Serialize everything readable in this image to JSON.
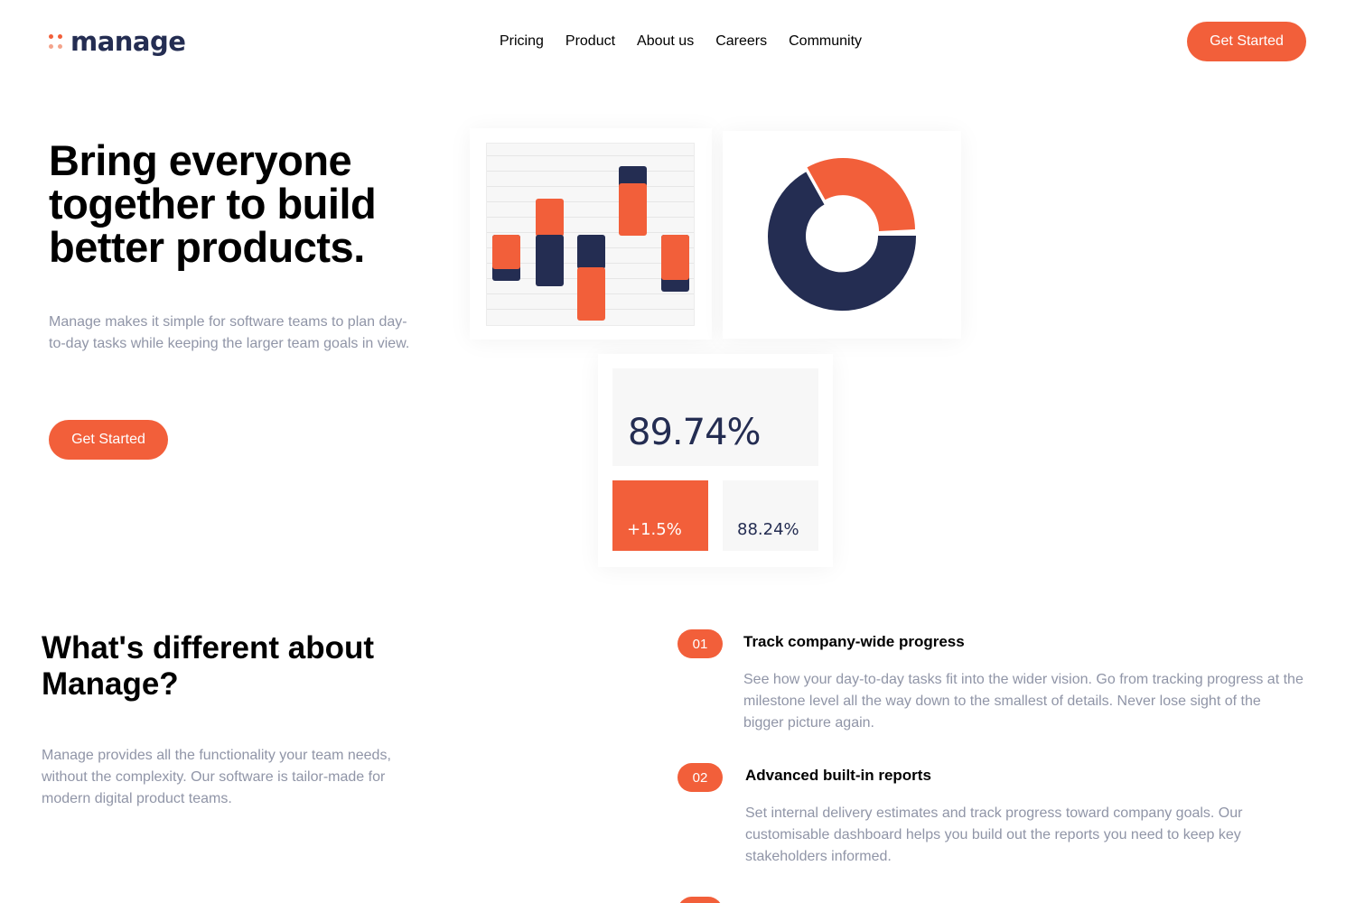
{
  "brand": {
    "name": "manage",
    "logo_icon": "four-dot-logo-icon",
    "accent": "#f25f3a",
    "navy": "#242d52"
  },
  "nav": {
    "items": [
      "Pricing",
      "Product",
      "About us",
      "Careers",
      "Community"
    ]
  },
  "header": {
    "cta_label": "Get Started"
  },
  "hero": {
    "title": "Bring everyone together to build better products.",
    "description": "Manage makes it simple for software teams to plan day-to-day tasks while keeping the larger team goals in view.",
    "cta_label": "Get Started"
  },
  "illustration": {
    "stat_main": "89.74%",
    "stat_change": "+1.5%",
    "stat_secondary": "88.24%"
  },
  "about": {
    "title": "What's different about Manage?",
    "description": "Manage provides all the functionality your team needs, without the complexity. Our software is tailor-made for modern digital product teams."
  },
  "features": [
    {
      "number": "01",
      "title": "Track company-wide progress",
      "description": "See how your day-to-day tasks fit into the wider vision. Go from tracking progress at the milestone level all the way down to the smallest of details. Never lose sight of the bigger picture again."
    },
    {
      "number": "02",
      "title": "Advanced built-in reports",
      "description": "Set internal delivery estimates and track progress toward company goals. Our customisable dashboard helps you build out the reports you need to keep key stakeholders informed."
    }
  ]
}
